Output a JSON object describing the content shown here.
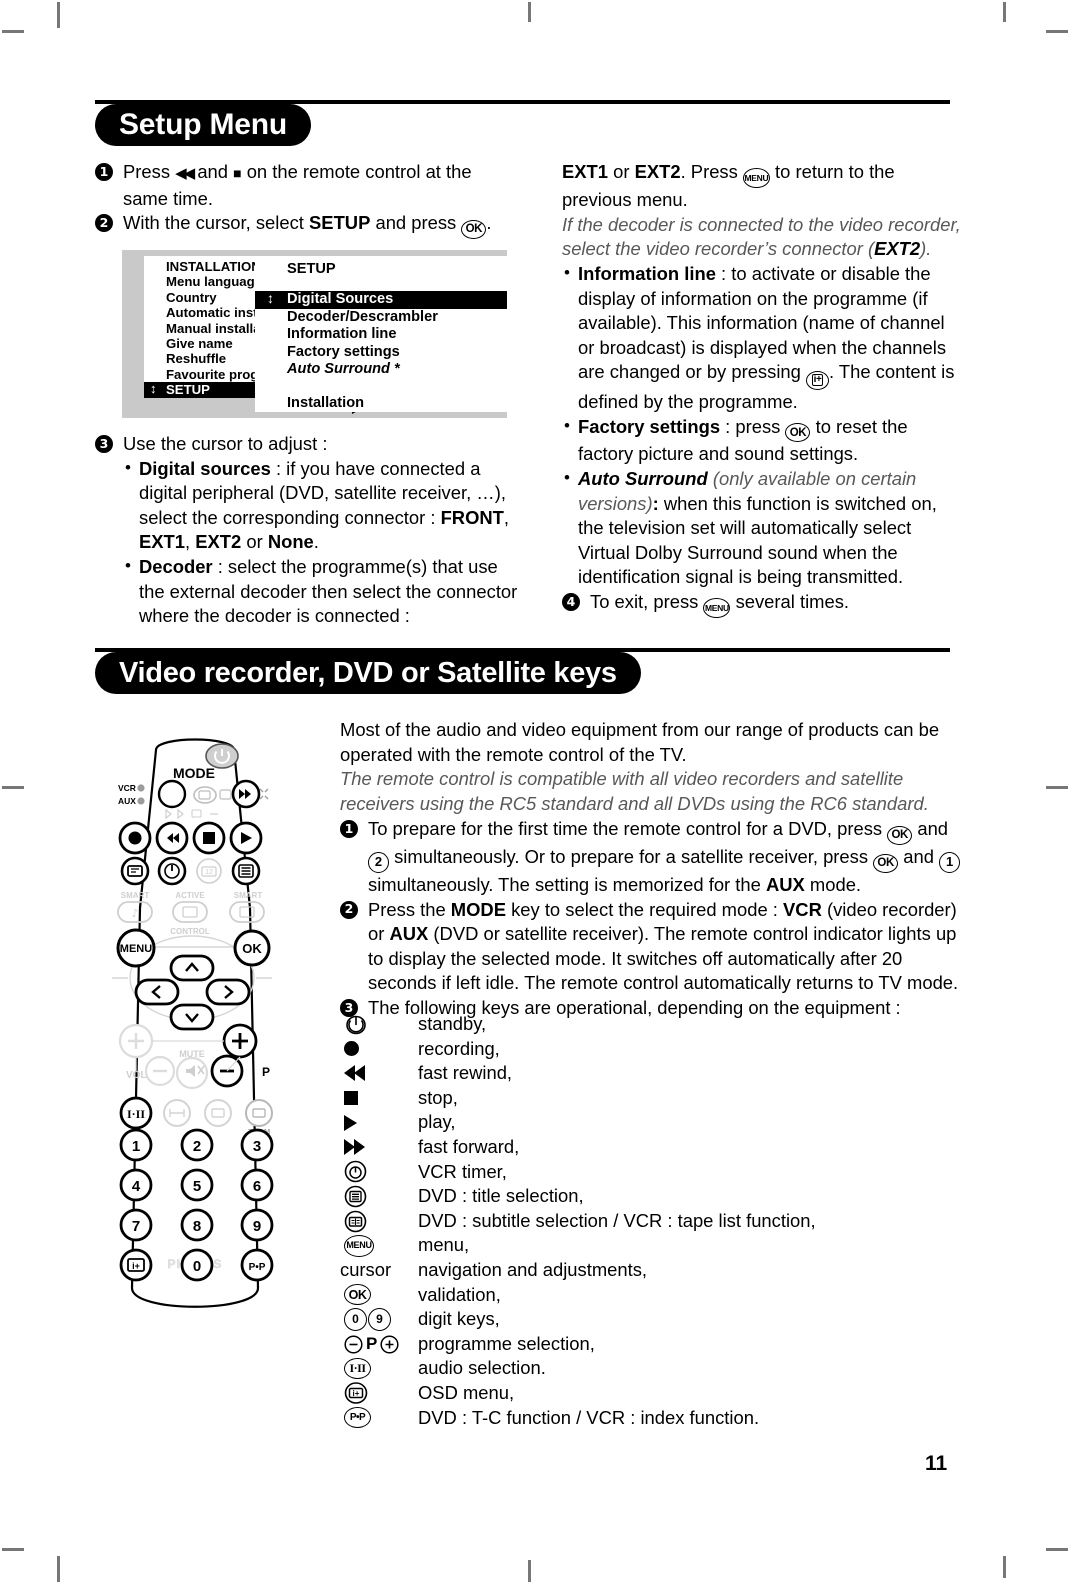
{
  "page": {
    "number": "11",
    "brand": "PHILIPS"
  },
  "sections": [
    {
      "id": "setup",
      "title": "Setup Menu"
    },
    {
      "id": "video",
      "title": "Video recorder, DVD or Satellite keys"
    }
  ],
  "setup": {
    "step1": {
      "num": "1",
      "text_a": "Press ",
      "text_b": " and ",
      "text_c": " on the remote control at the same time."
    },
    "step2": {
      "num": "2",
      "text_a": "With the cursor, select ",
      "bold": "SETUP",
      "text_b": " and press ",
      "key": "OK",
      "text_c": "."
    },
    "step3": {
      "num": "3",
      "text": "Use the cursor to adjust :"
    },
    "step4": {
      "num": "4",
      "text_a": "To exit, press ",
      "key": "MENU",
      "text_b": " several times."
    },
    "bullets": {
      "digital_sources": {
        "label": "Digital sources",
        "text_a": " : if you have connected a digital peripheral (DVD, satellite receiver, …), select the corresponding connector : ",
        "c1": "FRONT",
        "sep1": ", ",
        "c2": "EXT1",
        "sep2": ", ",
        "c3": "EXT2",
        "sep3": " or ",
        "c4": "None",
        "end": "."
      },
      "decoder": {
        "label": "Decoder",
        "text_a": " : select the programme(s) that use the external decoder then select the connector where the decoder is connected : ",
        "c1": "EXT1",
        "sep1": " or ",
        "c2": "EXT2",
        "text_b": ". Press ",
        "key": "MENU",
        "text_c": " to return to the previous menu.",
        "note_a": "If the decoder is connected to the video recorder, select the video recorder’s connector (",
        "note_bold": "EXT2",
        "note_b": ")."
      },
      "information_line": {
        "label": "Information line",
        "text_a": " : to activate or disable the display of information on the programme (if available). This information (name of channel or broadcast) is displayed when the channels are changed or by pressing ",
        "key": "OSD",
        "text_b": ". The content is defined by the programme."
      },
      "factory_settings": {
        "label": "Factory settings",
        "text_a": " : press ",
        "key": "OK",
        "text_b": " to reset the factory picture and sound settings."
      },
      "auto_surround": {
        "label": "Auto Surround",
        "note": " (only available on certain versions)",
        "colon": ":",
        "text": "when this function is switched on, the television set will automatically select Virtual Dolby Surround sound when the identification signal is being transmitted."
      }
    }
  },
  "osd": {
    "left": {
      "items": [
        {
          "label": "INSTALLATION",
          "selected": false
        },
        {
          "label": "Menu language",
          "selected": false
        },
        {
          "label": "Country",
          "selected": false
        },
        {
          "label": "Automatic installat",
          "selected": false
        },
        {
          "label": "Manual installation",
          "selected": false
        },
        {
          "label": "Give name",
          "selected": false
        },
        {
          "label": "Reshuffle",
          "selected": false
        },
        {
          "label": "Favourite programi",
          "selected": false
        },
        {
          "label": "SETUP",
          "selected": true
        }
      ]
    },
    "right": {
      "title": "SETUP",
      "items": [
        {
          "label": "Digital Sources",
          "selected": true,
          "italic": false
        },
        {
          "label": "Decoder/Descrambler",
          "selected": false,
          "italic": false
        },
        {
          "label": "Information line",
          "selected": false,
          "italic": false
        },
        {
          "label": "Factory settings",
          "selected": false,
          "italic": false
        },
        {
          "label": "Auto Surround *",
          "selected": false,
          "italic": true
        }
      ],
      "footer": "Installation"
    }
  },
  "video": {
    "intro_1": "Most of the audio and video equipment from our range of products can be operated with the remote control of the TV.",
    "intro_2": "The remote control is compatible with all video recorders and satellite receivers using the RC5 standard and all DVDs using the RC6 standard.",
    "step1": {
      "num": "1",
      "a": "To prepare for the first time the remote control for a DVD, press ",
      "k1": "OK",
      "b": " and ",
      "k2": "2",
      "c": " simultaneously. Or to prepare for a satellite receiver, press ",
      "k3": "OK",
      "d": " and ",
      "k4": "1",
      "e": " simultaneously. The setting is memorized for the ",
      "bold": "AUX",
      "f": " mode."
    },
    "step2": {
      "num": "2",
      "a": "Press the ",
      "b1": "MODE",
      "b": " key to select the required mode : ",
      "b2": "VCR",
      "c": " (video recorder) or ",
      "b3": "AUX",
      "d": " (DVD or satellite receiver). The remote control indicator lights up to display the selected mode. It switches off automatically after 20 seconds if left idle. The remote control automatically returns to TV mode."
    },
    "step3": {
      "num": "3",
      "text": "The following keys are operational, depending on the equipment :"
    },
    "keys": [
      {
        "icon": "standby-icon",
        "glyph": "standby",
        "label": "standby,"
      },
      {
        "icon": "record-icon",
        "glyph": "record",
        "label": "recording,"
      },
      {
        "icon": "fast-rewind-icon",
        "glyph": "rewind",
        "label": "fast rewind,"
      },
      {
        "icon": "stop-icon",
        "glyph": "stop",
        "label": "stop,"
      },
      {
        "icon": "play-icon",
        "glyph": "play",
        "label": "play,"
      },
      {
        "icon": "fast-forward-icon",
        "glyph": "forward",
        "label": "fast forward,"
      },
      {
        "icon": "vcr-timer-icon",
        "glyph": "timer",
        "label": "VCR timer,"
      },
      {
        "icon": "title-list-icon",
        "glyph": "list",
        "label": "DVD : title selection,"
      },
      {
        "icon": "subtitle-icon",
        "glyph": "subtitle",
        "label": "DVD : subtitle selection / VCR : tape list function,"
      },
      {
        "icon": "menu-key-icon",
        "glyph": "menu",
        "label": "menu,"
      },
      {
        "icon": "cursor-keys-icon",
        "glyph": "cursor",
        "label": "navigation and adjustments,"
      },
      {
        "icon": "ok-key-icon",
        "glyph": "ok",
        "label": "validation,"
      },
      {
        "icon": "digit-keys-icon",
        "glyph": "digits",
        "label": "digit keys,"
      },
      {
        "icon": "programme-keys-icon",
        "glyph": "prog",
        "label": "programme selection,"
      },
      {
        "icon": "audio-select-icon",
        "glyph": "audio",
        "label": "audio selection."
      },
      {
        "icon": "osd-menu-icon",
        "glyph": "osd",
        "label": "OSD menu,"
      },
      {
        "icon": "pp-key-icon",
        "glyph": "pp",
        "label": "DVD : T-C function / VCR : index function."
      }
    ]
  },
  "remote": {
    "mode_label": "MODE",
    "vcr_label": "VCR",
    "aux_label": "AUX",
    "smart_left": "SMART",
    "active_label": "ACTIVE",
    "smart_right": "SMART",
    "control_label": "CONTROL",
    "menu_label": "MENU",
    "ok_label": "OK",
    "vol_label": "VOL",
    "mute_label": "MUTE",
    "p_label": "P",
    "zoom_label": "ZOOM",
    "audio_label": "I·II",
    "digits": [
      "1",
      "2",
      "3",
      "4",
      "5",
      "6",
      "7",
      "8",
      "9",
      "0"
    ],
    "pp_label": "P•P",
    "brand": "PHILIPS"
  }
}
